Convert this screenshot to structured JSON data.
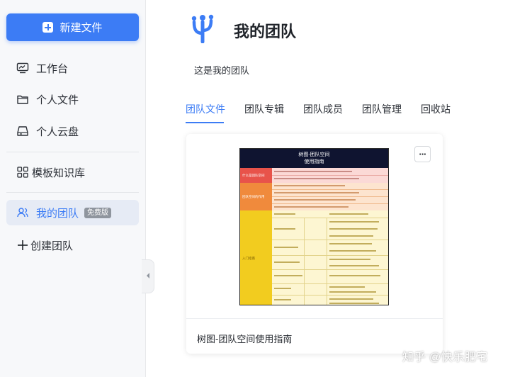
{
  "sidebar": {
    "new_file_label": "新建文件",
    "items": [
      {
        "label": "工作台",
        "icon": "monitor-icon"
      },
      {
        "label": "个人文件",
        "icon": "folder-icon"
      },
      {
        "label": "个人云盘",
        "icon": "drive-icon"
      },
      {
        "label": "模板知识库",
        "icon": "grid-icon"
      },
      {
        "label": "我的团队",
        "icon": "team-icon",
        "badge": "免费版",
        "active": true
      },
      {
        "label": "创建团队",
        "icon": "plus-icon"
      }
    ]
  },
  "team": {
    "title": "我的团队",
    "description": "这是我的团队"
  },
  "tabs": [
    {
      "label": "团队文件",
      "active": true
    },
    {
      "label": "团队专辑"
    },
    {
      "label": "团队成员"
    },
    {
      "label": "团队管理"
    },
    {
      "label": "回收站"
    }
  ],
  "card": {
    "title": "树图-团队空间使用指南",
    "more_label": "···",
    "thumbnail": {
      "heading_line1": "树图-团队空间",
      "heading_line2": "使用指南",
      "categories": [
        {
          "label": "什么是团队空间",
          "color": "#e8534a"
        },
        {
          "label": "团队空间的作用",
          "color": "#f08a3c"
        },
        {
          "label": "入门指南",
          "color": "#f2cc1f"
        }
      ]
    }
  },
  "watermark": "知乎 @快乐肥宅",
  "colors": {
    "accent": "#3c7cf5",
    "sidebar_bg": "#f7f8fa",
    "active_bg": "#e6ebf5"
  }
}
